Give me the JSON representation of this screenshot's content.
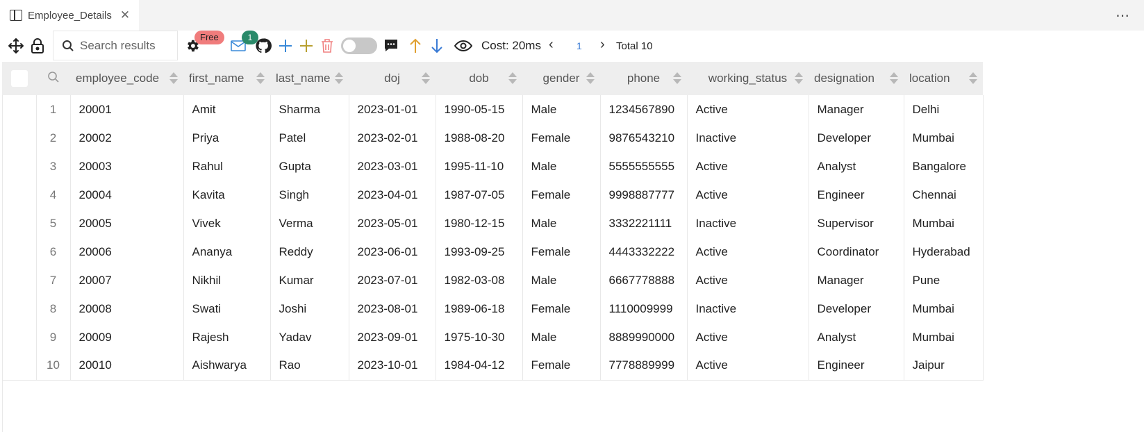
{
  "tab": {
    "title": "Employee_Details",
    "close": "✕"
  },
  "more": "⋯",
  "toolbar": {
    "search_placeholder": "Search results",
    "free_badge": "Free",
    "notification_count": "1",
    "cost": "Cost: 20ms",
    "prev": "‹",
    "page": "1",
    "next": "›",
    "total": "Total 10",
    "colors": {
      "plus_blue": "#3a8ad8",
      "plus_gold": "#b8a030",
      "trash": "#f08080",
      "up": "#e0a030",
      "down": "#3a7bd5"
    }
  },
  "table": {
    "headers": [
      "employee_code",
      "first_name",
      "last_name",
      "doj",
      "dob",
      "gender",
      "phone",
      "working_status",
      "designation",
      "location"
    ],
    "rows": [
      [
        "1",
        "20001",
        "Amit",
        "Sharma",
        "2023-01-01",
        "1990-05-15",
        "Male",
        "1234567890",
        "Active",
        "Manager",
        "Delhi"
      ],
      [
        "2",
        "20002",
        "Priya",
        "Patel",
        "2023-02-01",
        "1988-08-20",
        "Female",
        "9876543210",
        "Inactive",
        "Developer",
        "Mumbai"
      ],
      [
        "3",
        "20003",
        "Rahul",
        "Gupta",
        "2023-03-01",
        "1995-11-10",
        "Male",
        "5555555555",
        "Active",
        "Analyst",
        "Bangalore"
      ],
      [
        "4",
        "20004",
        "Kavita",
        "Singh",
        "2023-04-01",
        "1987-07-05",
        "Female",
        "9998887777",
        "Active",
        "Engineer",
        "Chennai"
      ],
      [
        "5",
        "20005",
        "Vivek",
        "Verma",
        "2023-05-01",
        "1980-12-15",
        "Male",
        "3332221111",
        "Inactive",
        "Supervisor",
        "Mumbai"
      ],
      [
        "6",
        "20006",
        "Ananya",
        "Reddy",
        "2023-06-01",
        "1993-09-25",
        "Female",
        "4443332222",
        "Active",
        "Coordinator",
        "Hyderabad"
      ],
      [
        "7",
        "20007",
        "Nikhil",
        "Kumar",
        "2023-07-01",
        "1982-03-08",
        "Male",
        "6667778888",
        "Active",
        "Manager",
        "Pune"
      ],
      [
        "8",
        "20008",
        "Swati",
        "Joshi",
        "2023-08-01",
        "1989-06-18",
        "Female",
        "1110009999",
        "Inactive",
        "Developer",
        "Mumbai"
      ],
      [
        "9",
        "20009",
        "Rajesh",
        "Yadav",
        "2023-09-01",
        "1975-10-30",
        "Male",
        "8889990000",
        "Active",
        "Analyst",
        "Mumbai"
      ],
      [
        "10",
        "20010",
        "Aishwarya",
        "Rao",
        "2023-10-01",
        "1984-04-12",
        "Female",
        "7778889999",
        "Active",
        "Engineer",
        "Jaipur"
      ]
    ]
  }
}
